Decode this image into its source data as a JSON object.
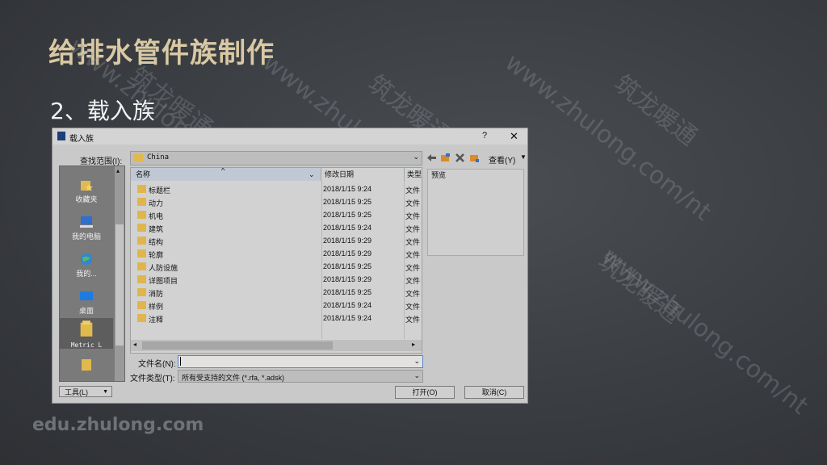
{
  "slide": {
    "title": "给排水管件族制作",
    "subtitle": "2、载入族",
    "brand": "edu.zhulong.com",
    "watermarks": [
      "www.zhulong.com/nt",
      "筑龙暖通"
    ]
  },
  "dialog": {
    "title": "载入族",
    "help": "?",
    "close": "✕",
    "look_in_label": "查找范围(I):",
    "look_in_value": "China",
    "view_label": "查看(Y)",
    "places": [
      "收藏夹",
      "我的电脑",
      "我的...",
      "桌面",
      "Metric L"
    ],
    "columns": [
      "名称",
      "修改日期",
      "类型"
    ],
    "files": [
      {
        "name": "标题栏",
        "date": "2018/1/15 9:24",
        "type": "文件"
      },
      {
        "name": "动力",
        "date": "2018/1/15 9:25",
        "type": "文件"
      },
      {
        "name": "机电",
        "date": "2018/1/15 9:25",
        "type": "文件"
      },
      {
        "name": "建筑",
        "date": "2018/1/15 9:24",
        "type": "文件"
      },
      {
        "name": "结构",
        "date": "2018/1/15 9:29",
        "type": "文件"
      },
      {
        "name": "轮廓",
        "date": "2018/1/15 9:29",
        "type": "文件"
      },
      {
        "name": "人防设施",
        "date": "2018/1/15 9:25",
        "type": "文件"
      },
      {
        "name": "详图项目",
        "date": "2018/1/15 9:29",
        "type": "文件"
      },
      {
        "name": "消防",
        "date": "2018/1/15 9:25",
        "type": "文件"
      },
      {
        "name": "样例",
        "date": "2018/1/15 9:24",
        "type": "文件"
      },
      {
        "name": "注释",
        "date": "2018/1/15 9:24",
        "type": "文件"
      }
    ],
    "preview_label": "预览",
    "filename_label": "文件名(N):",
    "filename_value": "",
    "filetype_label": "文件类型(T):",
    "filetype_value": "所有受支持的文件 (*.rfa, *.adsk)",
    "tools_label": "工具(L)",
    "open_label": "打开(O)",
    "cancel_label": "取消(C)"
  }
}
